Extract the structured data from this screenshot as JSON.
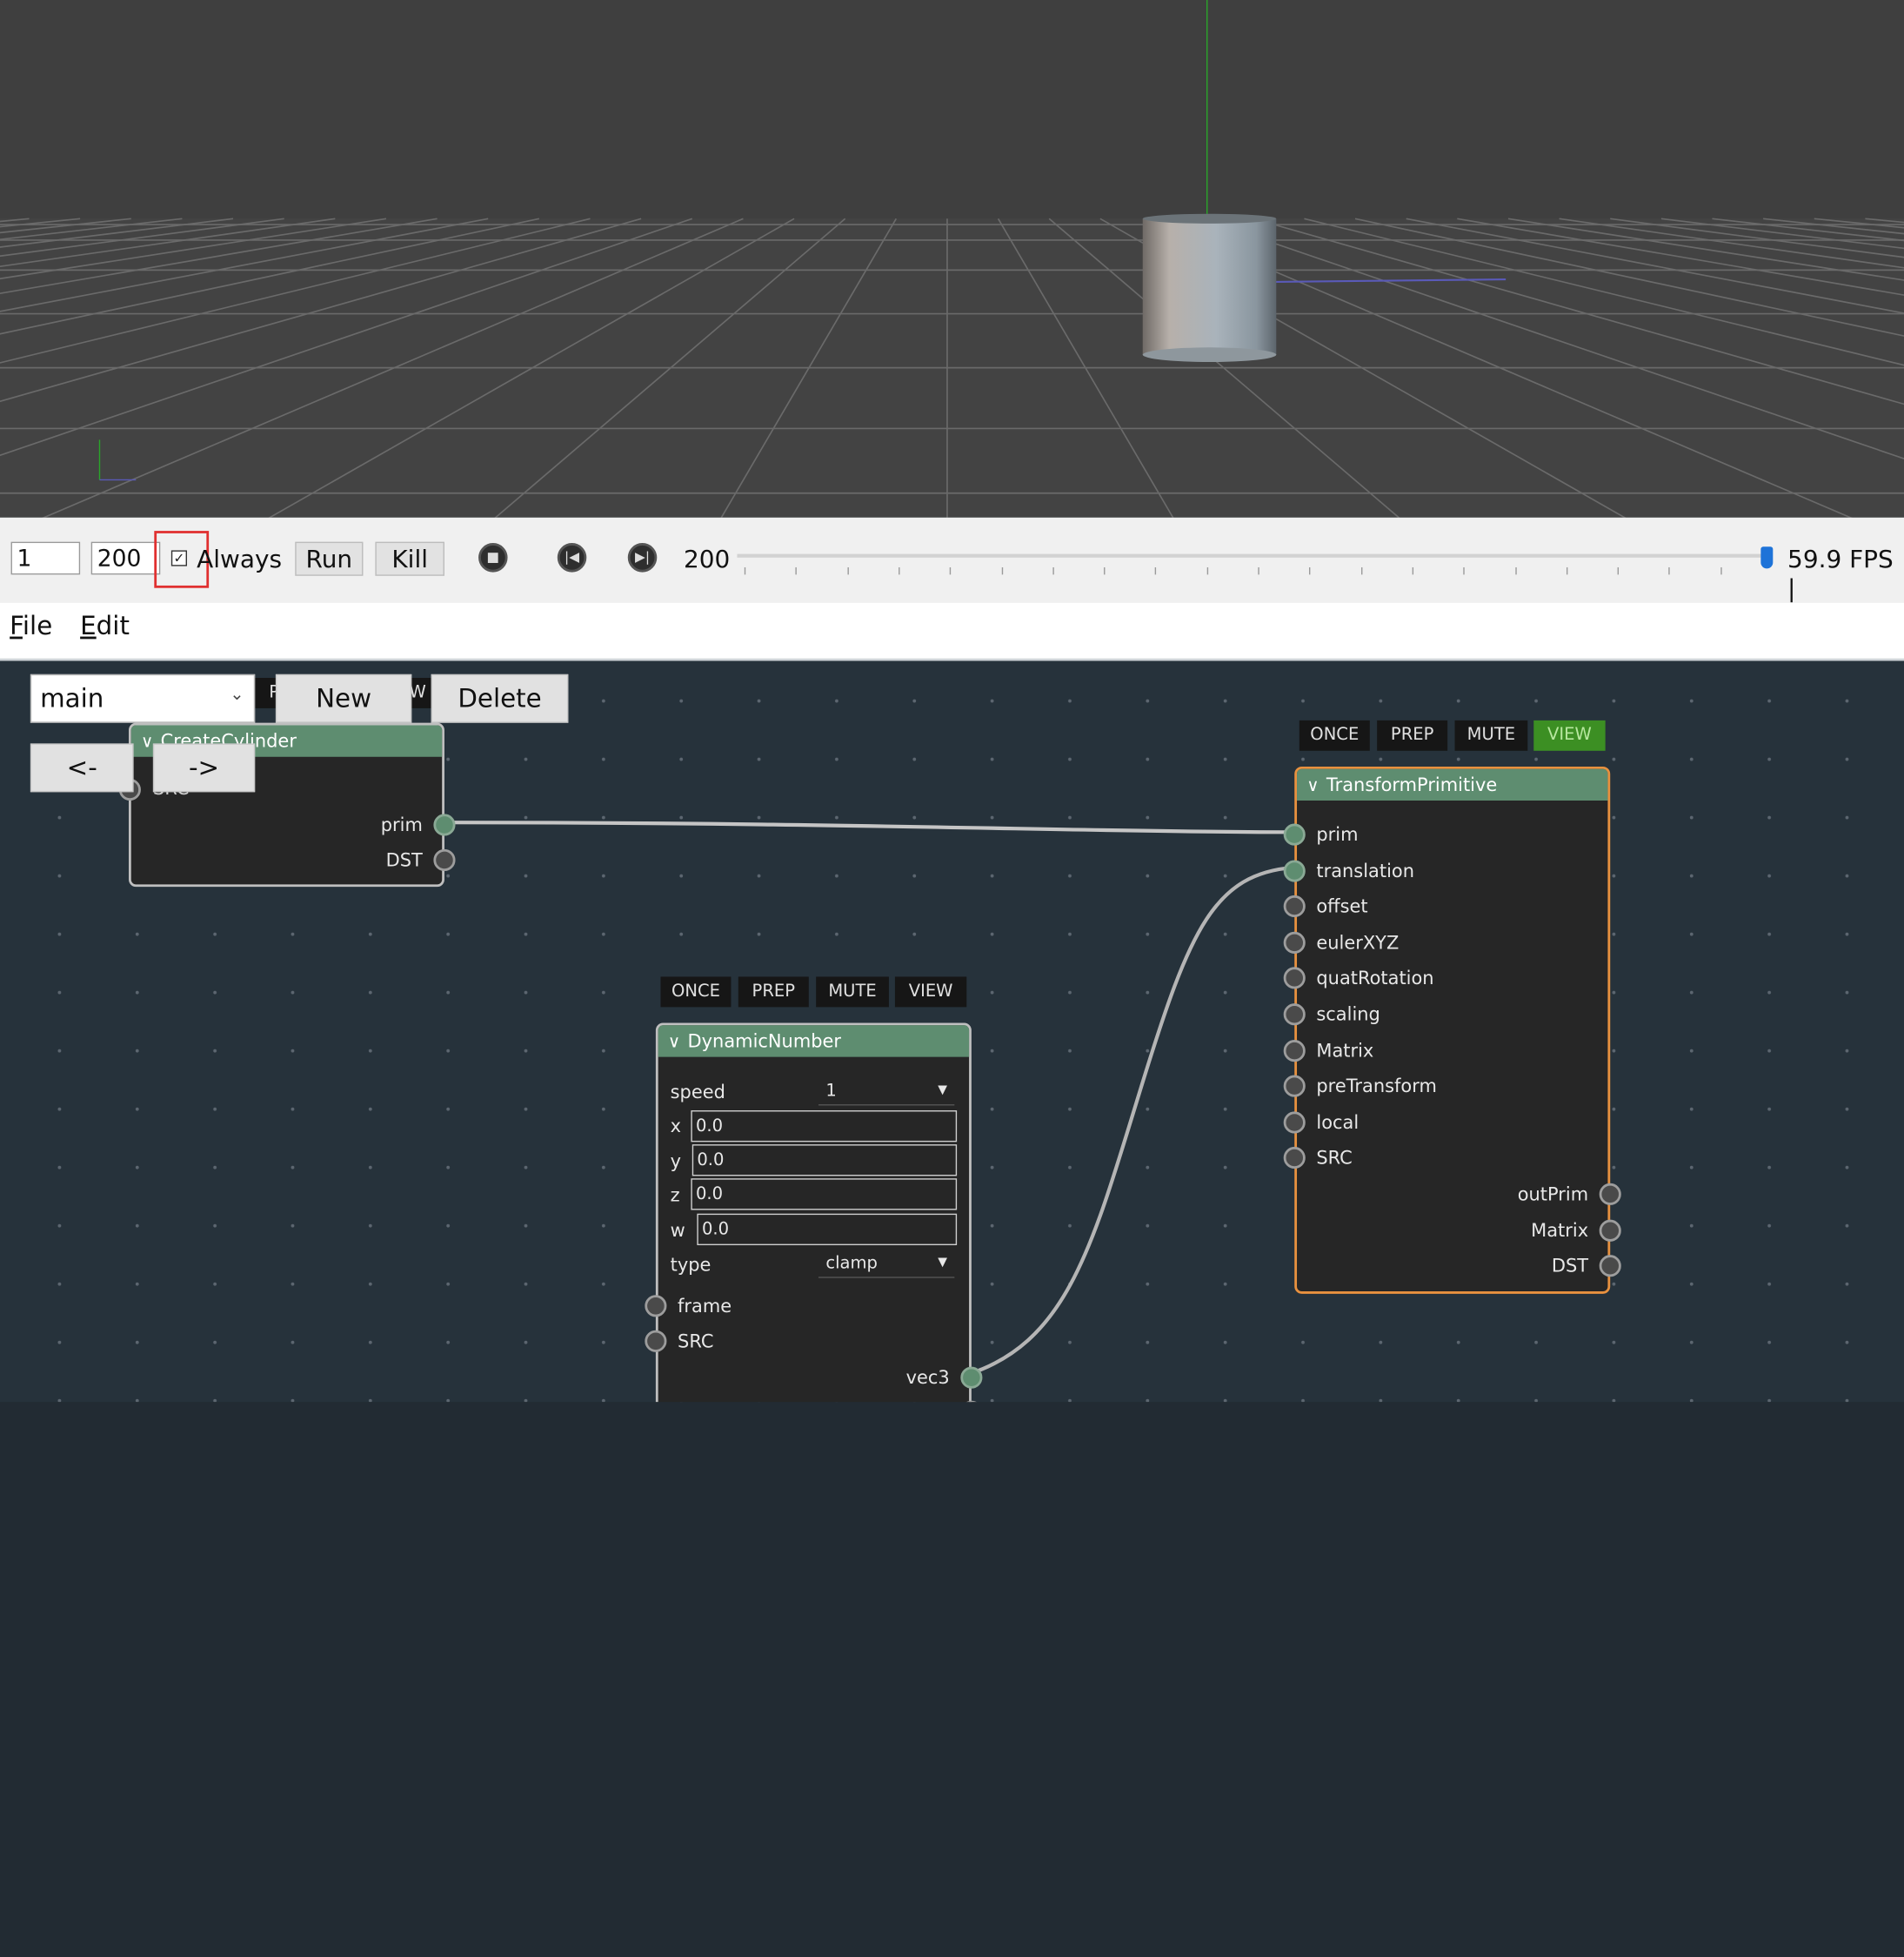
{
  "timeline": {
    "start_frame": "1",
    "end_frame": "200",
    "always_checked": true,
    "always_label": "Always",
    "run_label": "Run",
    "kill_label": "Kill",
    "current_frame": "200",
    "fps": "59.9 FPS |",
    "slider_position": 1.0
  },
  "menubar": {
    "file": {
      "underline": "F",
      "rest": "ile"
    },
    "edit": {
      "underline": "E",
      "rest": "dit"
    }
  },
  "graph_controls": {
    "subgraph_value": "main",
    "new_label": "New",
    "delete_label": "Delete",
    "back_label": "<-",
    "forward_label": "->",
    "hidden_flag_left": "P",
    "hidden_flag_right": "W"
  },
  "nodes": {
    "create_cylinder": {
      "title": "CreateCylinder",
      "hidden_input": "SRC",
      "outputs": [
        "prim",
        "DST"
      ]
    },
    "transform_primitive": {
      "title": "TransformPrimitive",
      "flags": [
        "ONCE",
        "PREP",
        "MUTE",
        "VIEW"
      ],
      "active_flag": "VIEW",
      "inputs": [
        "prim",
        "translation",
        "offset",
        "eulerXYZ",
        "quatRotation",
        "scaling",
        "Matrix",
        "preTransform",
        "local",
        "SRC"
      ],
      "outputs": [
        "outPrim",
        "Matrix",
        "DST"
      ]
    },
    "dynamic_number": {
      "title": "DynamicNumber",
      "flags": [
        "ONCE",
        "PREP",
        "MUTE",
        "VIEW"
      ],
      "speed_label": "speed",
      "speed_value": "1",
      "x_label": "x",
      "x_value": "0.0",
      "y_label": "y",
      "y_value": "0.0",
      "z_label": "z",
      "z_value": "0.0",
      "w_label": "w",
      "w_value": "0.0",
      "type_label": "type",
      "type_value": "clamp",
      "inputs": [
        "frame",
        "SRC"
      ],
      "outputs": [
        "vec3"
      ]
    }
  },
  "colors": {
    "node_header": "#5e8d70",
    "selected_border": "#e8913f",
    "view_flag_active": "#3c8f23",
    "graph_background": "#26323b",
    "viewport_background": "#404040"
  }
}
